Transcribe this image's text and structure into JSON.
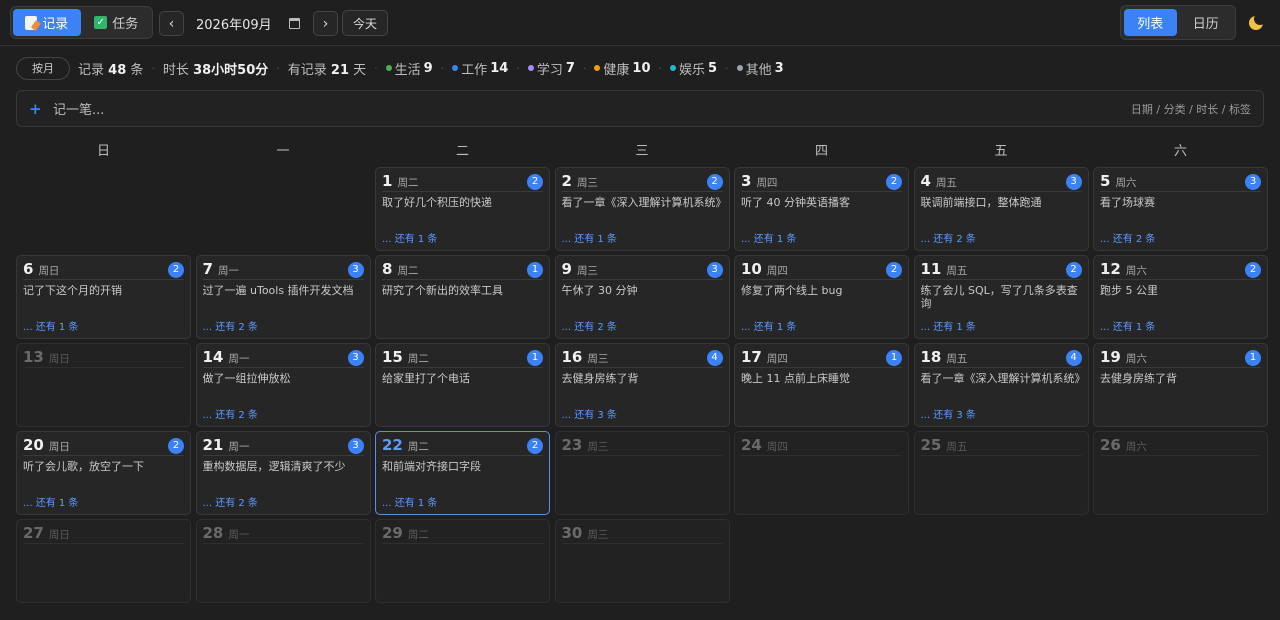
{
  "topbar": {
    "modes": [
      {
        "label": "记录",
        "active": true
      },
      {
        "label": "任务",
        "active": false
      }
    ],
    "prev": "‹",
    "next": "›",
    "month": "2026年09月",
    "today": "今天",
    "views": [
      {
        "label": "列表",
        "active": true
      },
      {
        "label": "日历",
        "active": false
      }
    ]
  },
  "stats": {
    "by": "按月",
    "records_label": "记录",
    "records_count": "48",
    "records_unit": "条",
    "duration_label": "时长",
    "duration_value": "38小时50分",
    "days_label": "有记录",
    "days_value": "21",
    "days_unit": "天",
    "categories": [
      {
        "name": "生活",
        "count": "9",
        "color": "#4caf50"
      },
      {
        "name": "工作",
        "count": "14",
        "color": "#3b82f6"
      },
      {
        "name": "学习",
        "count": "7",
        "color": "#a78bfa"
      },
      {
        "name": "健康",
        "count": "10",
        "color": "#f59e0b"
      },
      {
        "name": "娱乐",
        "count": "5",
        "color": "#22b8cf"
      },
      {
        "name": "其他",
        "count": "3",
        "color": "#9ca3af"
      }
    ]
  },
  "quick_add": {
    "placeholder": "记一笔...",
    "hint": "日期 / 分类 / 时长 / 标签"
  },
  "weekdays": [
    "日",
    "一",
    "二",
    "三",
    "四",
    "五",
    "六"
  ],
  "calendar": {
    "leading_blanks": 2,
    "days": [
      {
        "day": "1",
        "week": "周二",
        "count": "2",
        "entry": "取了好几个积压的快递",
        "more": "... 还有 1 条"
      },
      {
        "day": "2",
        "week": "周三",
        "count": "2",
        "entry": "看了一章《深入理解计算机系统》",
        "more": "... 还有 1 条"
      },
      {
        "day": "3",
        "week": "周四",
        "count": "2",
        "entry": "听了 40 分钟英语播客",
        "more": "... 还有 1 条"
      },
      {
        "day": "4",
        "week": "周五",
        "count": "3",
        "entry": "联调前端接口，整体跑通",
        "more": "... 还有 2 条"
      },
      {
        "day": "5",
        "week": "周六",
        "count": "3",
        "entry": "看了场球赛",
        "more": "... 还有 2 条"
      },
      {
        "day": "6",
        "week": "周日",
        "count": "2",
        "entry": "记了下这个月的开销",
        "more": "... 还有 1 条"
      },
      {
        "day": "7",
        "week": "周一",
        "count": "3",
        "entry": "过了一遍 uTools 插件开发文档",
        "more": "... 还有 2 条"
      },
      {
        "day": "8",
        "week": "周二",
        "count": "1",
        "entry": "研究了个新出的效率工具",
        "more": ""
      },
      {
        "day": "9",
        "week": "周三",
        "count": "3",
        "entry": "午休了 30 分钟",
        "more": "... 还有 2 条"
      },
      {
        "day": "10",
        "week": "周四",
        "count": "2",
        "entry": "修复了两个线上 bug",
        "more": "... 还有 1 条"
      },
      {
        "day": "11",
        "week": "周五",
        "count": "2",
        "entry": "练了会儿 SQL，写了几条多表查询",
        "more": "... 还有 1 条"
      },
      {
        "day": "12",
        "week": "周六",
        "count": "2",
        "entry": "跑步 5 公里",
        "more": "... 还有 1 条"
      },
      {
        "day": "13",
        "week": "周日",
        "count": "",
        "entry": "",
        "more": "",
        "dim": true
      },
      {
        "day": "14",
        "week": "周一",
        "count": "3",
        "entry": "做了一组拉伸放松",
        "more": "... 还有 2 条"
      },
      {
        "day": "15",
        "week": "周二",
        "count": "1",
        "entry": "给家里打了个电话",
        "more": ""
      },
      {
        "day": "16",
        "week": "周三",
        "count": "4",
        "entry": "去健身房练了背",
        "more": "... 还有 3 条"
      },
      {
        "day": "17",
        "week": "周四",
        "count": "1",
        "entry": "晚上 11 点前上床睡觉",
        "more": ""
      },
      {
        "day": "18",
        "week": "周五",
        "count": "4",
        "entry": "看了一章《深入理解计算机系统》",
        "more": "... 还有 3 条"
      },
      {
        "day": "19",
        "week": "周六",
        "count": "1",
        "entry": "去健身房练了背",
        "more": ""
      },
      {
        "day": "20",
        "week": "周日",
        "count": "2",
        "entry": "听了会儿歌，放空了一下",
        "more": "... 还有 1 条"
      },
      {
        "day": "21",
        "week": "周一",
        "count": "3",
        "entry": "重构数据层，逻辑清爽了不少",
        "more": "... 还有 2 条"
      },
      {
        "day": "22",
        "week": "周二",
        "count": "2",
        "entry": "和前端对齐接口字段",
        "more": "... 还有 1 条",
        "today": true
      },
      {
        "day": "23",
        "week": "周三",
        "count": "",
        "entry": "",
        "more": "",
        "dim": true
      },
      {
        "day": "24",
        "week": "周四",
        "count": "",
        "entry": "",
        "more": "",
        "dim": true
      },
      {
        "day": "25",
        "week": "周五",
        "count": "",
        "entry": "",
        "more": "",
        "dim": true
      },
      {
        "day": "26",
        "week": "周六",
        "count": "",
        "entry": "",
        "more": "",
        "dim": true
      },
      {
        "day": "27",
        "week": "周日",
        "count": "",
        "entry": "",
        "more": "",
        "dim": true
      },
      {
        "day": "28",
        "week": "周一",
        "count": "",
        "entry": "",
        "more": "",
        "dim": true
      },
      {
        "day": "29",
        "week": "周二",
        "count": "",
        "entry": "",
        "more": "",
        "dim": true
      },
      {
        "day": "30",
        "week": "周三",
        "count": "",
        "entry": "",
        "more": "",
        "dim": true
      }
    ]
  }
}
